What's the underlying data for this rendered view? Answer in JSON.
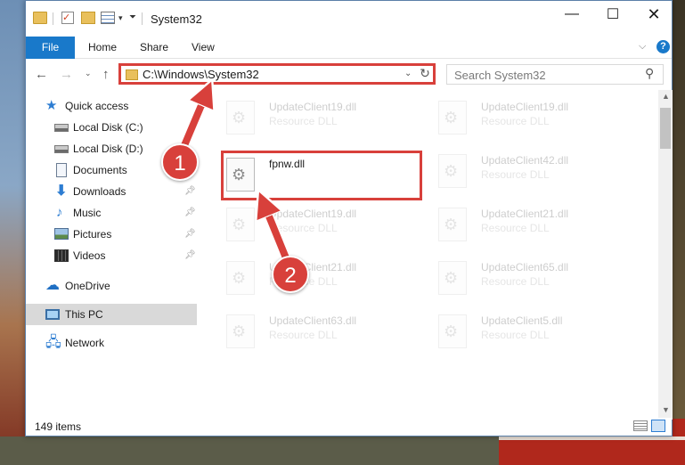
{
  "window": {
    "title": "System32",
    "min_glyph": "—",
    "max_glyph": "☐",
    "close_glyph": "✕"
  },
  "ribbon": {
    "tabs": [
      "File",
      "Home",
      "Share",
      "View"
    ],
    "help_glyph": "?"
  },
  "address": {
    "path": "C:\\Windows\\System32",
    "search_placeholder": "Search System32"
  },
  "sidebar": {
    "items": [
      {
        "label": "Quick access",
        "icon": "star-icon",
        "pinned": false
      },
      {
        "label": "Local Disk (C:)",
        "icon": "disk-icon",
        "pinned": false
      },
      {
        "label": "Local Disk (D:)",
        "icon": "disk-icon",
        "pinned": false
      },
      {
        "label": "Documents",
        "icon": "documents-icon",
        "pinned": false
      },
      {
        "label": "Downloads",
        "icon": "download-icon",
        "pinned": true
      },
      {
        "label": "Music",
        "icon": "music-icon",
        "pinned": true
      },
      {
        "label": "Pictures",
        "icon": "pictures-icon",
        "pinned": true
      },
      {
        "label": "Videos",
        "icon": "videos-icon",
        "pinned": true
      },
      {
        "label": "OneDrive",
        "icon": "onedrive-icon",
        "pinned": false
      },
      {
        "label": "This PC",
        "icon": "this-pc-icon",
        "pinned": false,
        "selected": true
      },
      {
        "label": "Network",
        "icon": "network-icon",
        "pinned": false
      }
    ]
  },
  "files": [
    {
      "name": "UpdateClient19.dll",
      "type": "Resource DLL",
      "faded": true
    },
    {
      "name": "UpdateClient19.dll",
      "type": "Resource DLL",
      "faded": true
    },
    {
      "name": "fpnw.dll",
      "type": "",
      "faded": false,
      "highlighted": true
    },
    {
      "name": "UpdateClient42.dll",
      "type": "Resource DLL",
      "faded": true
    },
    {
      "name": "UpdateClient19.dll",
      "type": "Resource DLL",
      "faded": true
    },
    {
      "name": "UpdateClient21.dll",
      "type": "Resource DLL",
      "faded": true
    },
    {
      "name": "UpdateClient21.dll",
      "type": "Resource DLL",
      "faded": true
    },
    {
      "name": "UpdateClient65.dll",
      "type": "Resource DLL",
      "faded": true
    },
    {
      "name": "UpdateClient63.dll",
      "type": "Resource DLL",
      "faded": true
    },
    {
      "name": "UpdateClient5.dll",
      "type": "Resource DLL",
      "faded": true
    }
  ],
  "status": {
    "item_count": "149 items"
  },
  "annotations": {
    "step1": "1",
    "step2": "2",
    "accent_color": "#d8403b"
  },
  "colors": {
    "file_tab": "#1979ca",
    "highlight": "#d8403b",
    "selected_nav": "#d9d9d9"
  }
}
